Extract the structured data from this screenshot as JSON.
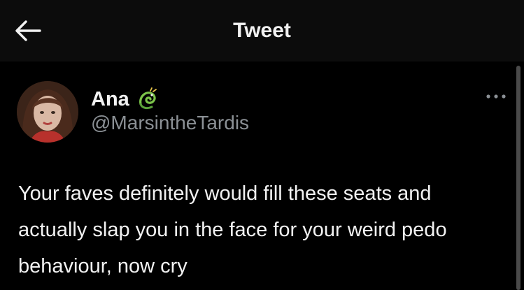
{
  "header": {
    "title": "Tweet",
    "back_icon": "arrow-left-icon"
  },
  "tweet": {
    "author": {
      "name": "Ana",
      "handle": "@MarsintheTardis",
      "name_emoji": "dragon-emoji-icon"
    },
    "more_icon": "more-horizontal-icon",
    "text": "Your faves definitely would fill these seats and actually slap you in the face for your weird pedo behaviour, now cry"
  },
  "colors": {
    "background": "#000000",
    "topbar": "#0c0c0c",
    "primary_text": "#f2f2f2",
    "secondary_text": "#8b9095"
  }
}
